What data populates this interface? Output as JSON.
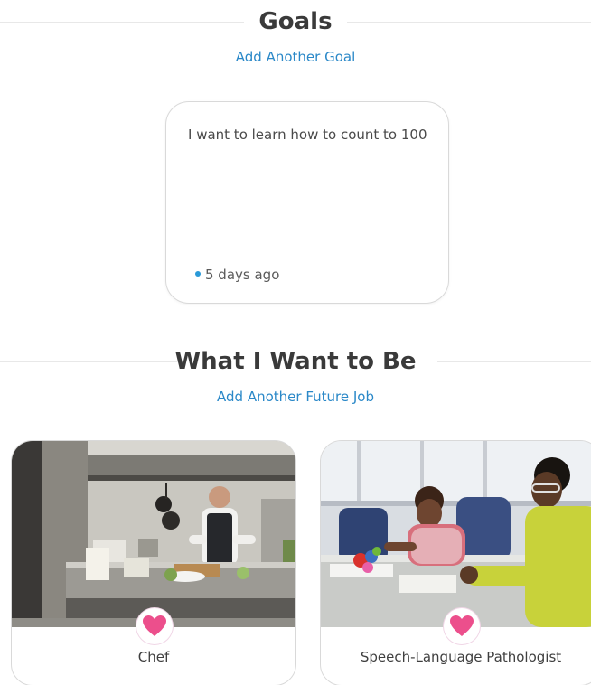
{
  "goals": {
    "heading": "Goals",
    "add_label": "Add Another Goal",
    "items": [
      {
        "text": "I want to learn how to count to 100",
        "time": "5 days ago"
      }
    ]
  },
  "future_jobs": {
    "heading": "What I Want to Be",
    "add_label": "Add Another Future Job",
    "items": [
      {
        "title": "Chef",
        "favorite_icon": "heart-icon"
      },
      {
        "title": "Speech-Language Pathologist",
        "favorite_icon": "heart-icon"
      }
    ]
  },
  "colors": {
    "link": "#2a88c8",
    "heart": "#ec4f8c",
    "dot": "#2a9ad8"
  }
}
